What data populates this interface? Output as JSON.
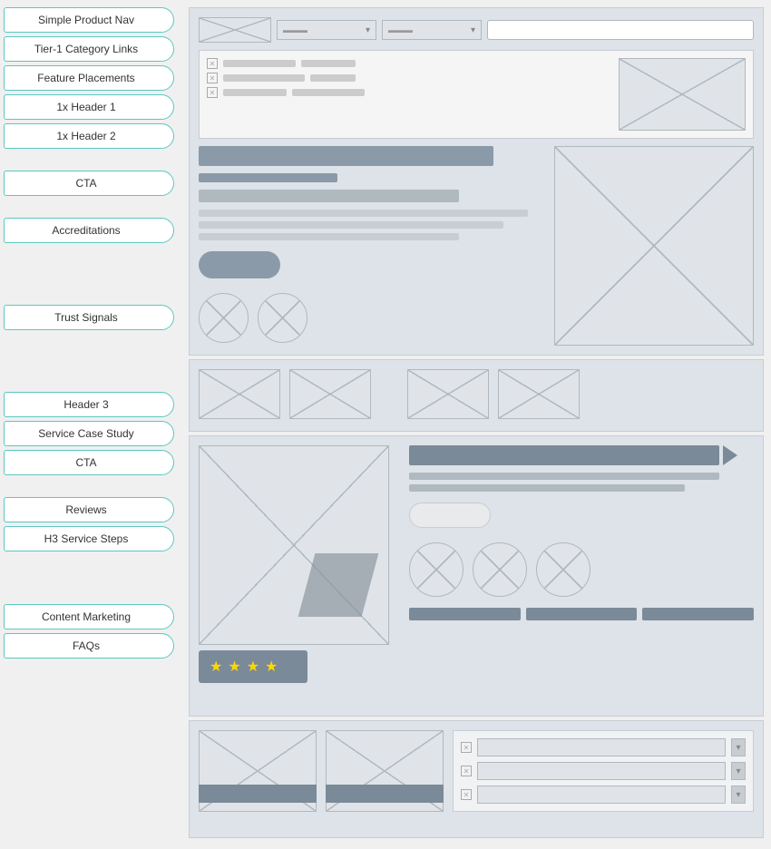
{
  "sidebar": {
    "section1_labels": [
      {
        "id": "simple-product-nav",
        "text": "Simple Product Nav"
      },
      {
        "id": "tier1-category-links",
        "text": "Tier-1 Category Links"
      },
      {
        "id": "feature-placements",
        "text": "Feature Placements"
      },
      {
        "id": "1x-header-1",
        "text": "1x Header 1"
      },
      {
        "id": "1x-header-2",
        "text": "1x Header 2"
      },
      {
        "id": "cta-1",
        "text": "CTA"
      },
      {
        "id": "accreditations",
        "text": "Accreditations"
      }
    ],
    "section2_labels": [
      {
        "id": "trust-signals",
        "text": "Trust Signals"
      }
    ],
    "section3_labels": [
      {
        "id": "header-3",
        "text": "Header 3"
      },
      {
        "id": "service-case-study",
        "text": "Service Case Study"
      },
      {
        "id": "cta-2",
        "text": "CTA"
      },
      {
        "id": "reviews",
        "text": "Reviews"
      },
      {
        "id": "h3-service-steps",
        "text": "H3 Service Steps"
      }
    ],
    "section4_labels": [
      {
        "id": "content-marketing",
        "text": "Content Marketing"
      },
      {
        "id": "faqs",
        "text": "FAQs"
      }
    ]
  },
  "icons": {
    "chevron": "▾",
    "close": "✕",
    "star": "★"
  }
}
